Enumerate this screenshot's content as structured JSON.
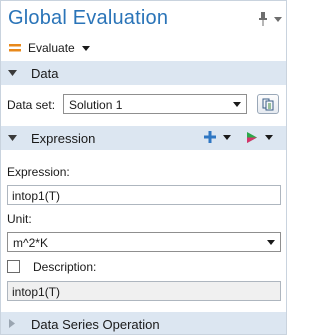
{
  "window": {
    "title": "Global Evaluation",
    "icons": [
      "pin-icon",
      "panel-menu-icon"
    ]
  },
  "toolbar": {
    "evaluate_label": "Evaluate",
    "evaluate_icon": "evaluate-equals-icon"
  },
  "sections": {
    "data": {
      "title": "Data",
      "expanded": true,
      "dataset_label": "Data set:",
      "dataset_value": "Solution 1",
      "tool_icon": "goto-source-icon"
    },
    "expression": {
      "title": "Expression",
      "expanded": true,
      "actions": [
        "add-expression-icon",
        "replace-expression-icon"
      ],
      "expression_label": "Expression:",
      "expression_value": "intop1(T)",
      "unit_label": "Unit:",
      "unit_value": "m^2*K",
      "description_label": "Description:",
      "description_checked": false,
      "description_value": "intop1(T)"
    },
    "data_series_operation": {
      "title": "Data Series Operation",
      "expanded": false
    }
  },
  "colors": {
    "title": "#2a74b8",
    "section_header_bg": "#dce6f1",
    "add_icon": "#2f77c3",
    "accent_orange": "#e8891b"
  }
}
